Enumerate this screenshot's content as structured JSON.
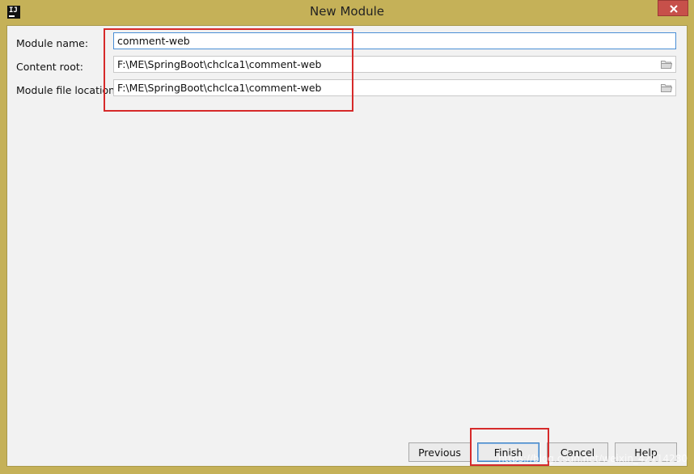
{
  "window": {
    "title": "New Module",
    "app_icon_text": "IJ",
    "close_icon": "close-icon"
  },
  "form": {
    "module_name": {
      "label": "Module name:",
      "value": "comment-web"
    },
    "content_root": {
      "label": "Content root:",
      "value": "F:\\ME\\SpringBoot\\chclca1\\comment-web",
      "browse_icon": "folder-icon"
    },
    "module_file_location": {
      "label": "Module file location:",
      "value": "F:\\ME\\SpringBoot\\chclca1\\comment-web",
      "browse_icon": "folder-icon"
    }
  },
  "buttons": {
    "previous": "Previous",
    "finish": "Finish",
    "cancel": "Cancel",
    "help": "Help"
  },
  "colors": {
    "titlebar": "#c5b158",
    "close": "#c7504a",
    "highlight": "#d62a2a",
    "focus": "#4a8fd6"
  },
  "watermark": "https://blog.csdn.net/weixin_42114280"
}
